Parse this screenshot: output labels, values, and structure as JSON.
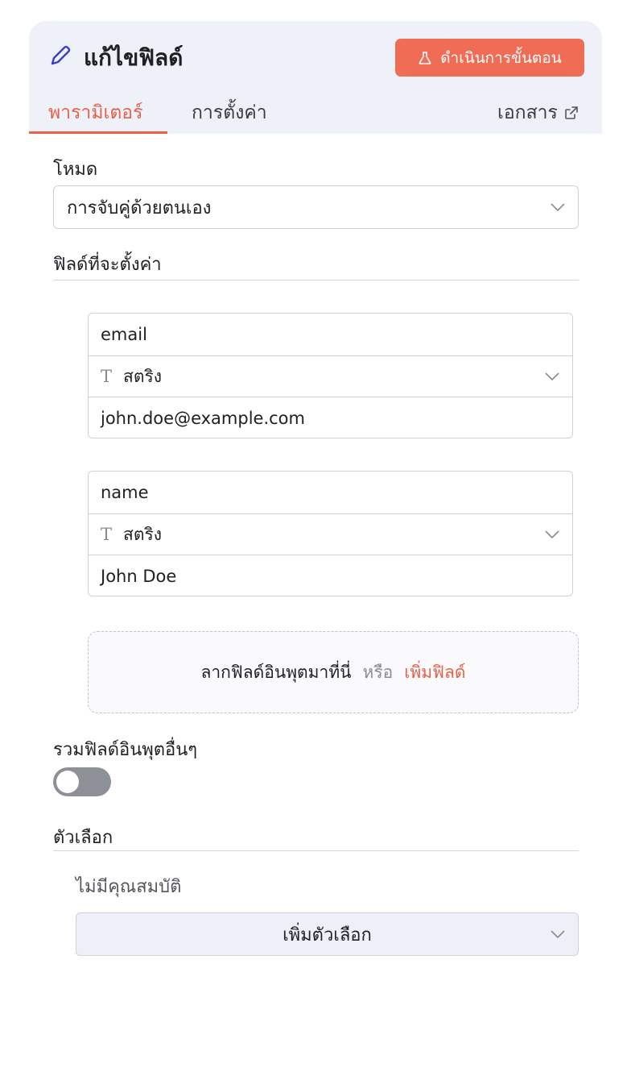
{
  "header": {
    "title": "แก้ไขฟิลด์",
    "execute_label": "ดำเนินการขั้นตอน",
    "tabs": [
      {
        "label": "พารามิเตอร์",
        "active": true
      },
      {
        "label": "การตั้งค่า",
        "active": false
      },
      {
        "label": "เอกสาร",
        "active": false
      }
    ],
    "accent_color": "#f06c55"
  },
  "mode": {
    "label": "โหมด",
    "value": "การจับคู่ด้วยตนเอง"
  },
  "fields_section": {
    "label": "ฟิลด์ที่จะตั้งค่า",
    "fields": [
      {
        "name": "email",
        "type": "สตริง",
        "value": "john.doe@example.com"
      },
      {
        "name": "name",
        "type": "สตริง",
        "value": "John Doe"
      }
    ],
    "dropzone": {
      "text": "ลากฟิลด์อินพุตมาที่นี่",
      "or": "หรือ",
      "add": "เพิ่มฟิลด์"
    }
  },
  "include_other": {
    "label": "รวมฟิลด์อินพุตอื่นๆ",
    "enabled": false
  },
  "options": {
    "label": "ตัวเลือก",
    "empty_text": "ไม่มีคุณสมบัติ",
    "add_label": "เพิ่มตัวเลือก"
  }
}
